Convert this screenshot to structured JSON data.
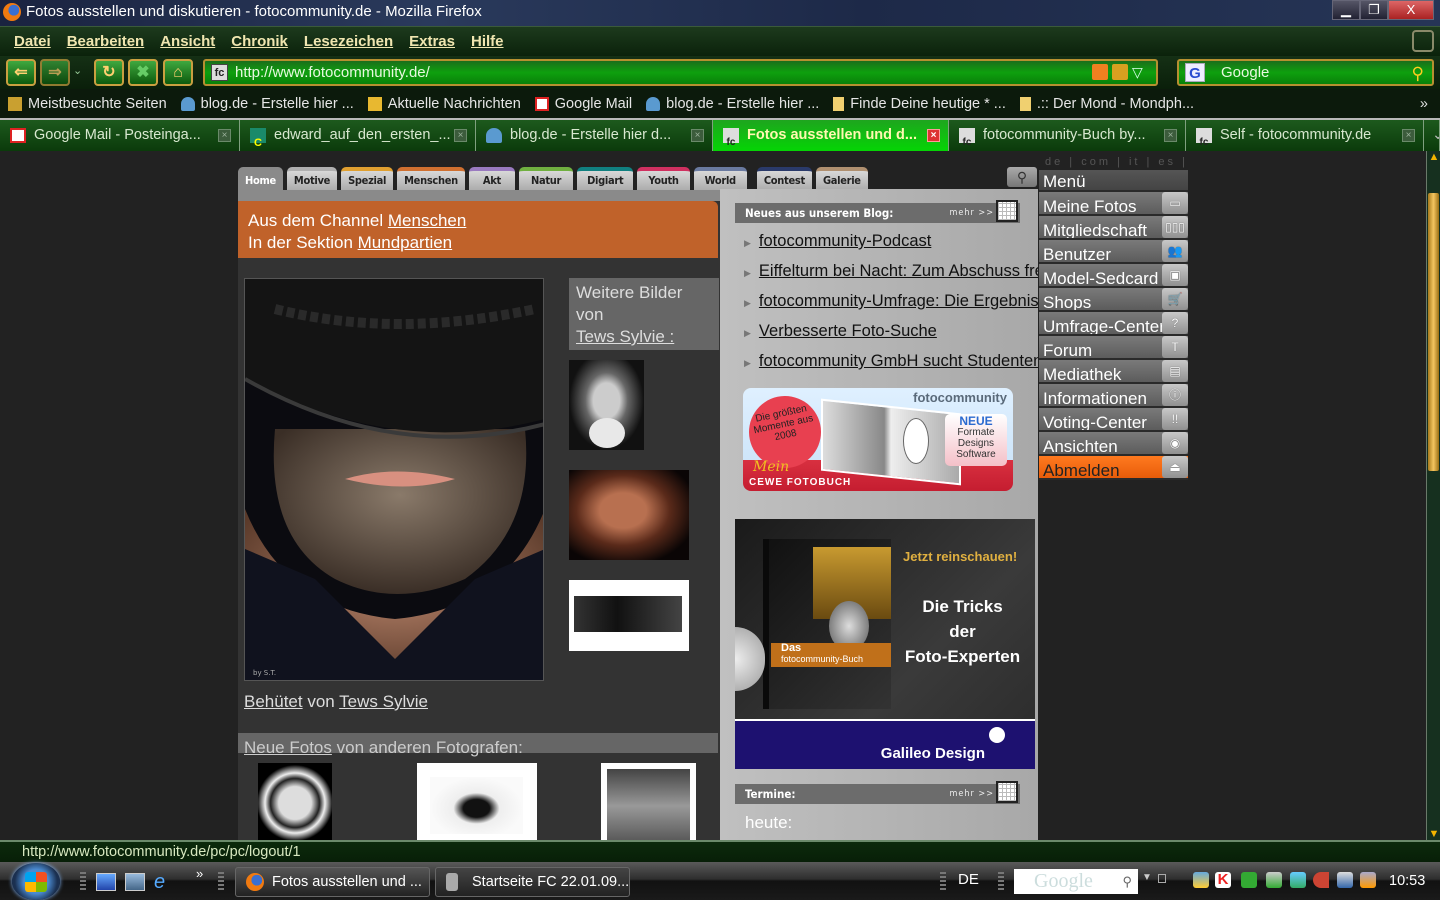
{
  "window": {
    "title": "Fotos ausstellen und diskutieren - fotocommunity.de - Mozilla Firefox",
    "controls": {
      "minimize": "▁",
      "restore": "❐",
      "close": "X"
    }
  },
  "menubar": [
    "Datei",
    "Bearbeiten",
    "Ansicht",
    "Chronik",
    "Lesezeichen",
    "Extras",
    "Hilfe"
  ],
  "navbar": {
    "back": "⇐",
    "forward": "⇒",
    "dropdown": "⌄",
    "reload": "↻",
    "stop": "✖",
    "home": "⌂",
    "url": "http://www.fotocommunity.de/",
    "site_icon": "fc",
    "search_engine": "G",
    "search_placeholder": "Google",
    "search_icon": "⚲"
  },
  "bookmarks": {
    "items": [
      {
        "label": "Meistbesuchte Seiten",
        "icon": "folder-icon"
      },
      {
        "label": "blog.de - Erstelle hier ...",
        "icon": "blog-icon"
      },
      {
        "label": "Aktuelle Nachrichten",
        "icon": "rss-folder-icon"
      },
      {
        "label": "Google Mail",
        "icon": "gmail-icon"
      },
      {
        "label": "blog.de - Erstelle hier ...",
        "icon": "blog-icon"
      },
      {
        "label": "Finde Deine heutige * ...",
        "icon": "page-icon"
      },
      {
        "label": ".:: Der Mond - Mondph...",
        "icon": "page-icon"
      }
    ],
    "more": "»"
  },
  "tabs": [
    {
      "label": "Google Mail - Posteinga...",
      "icon": "gmail-icon",
      "active": false
    },
    {
      "label": "edward_auf_den_ersten_...",
      "icon": "c-icon",
      "active": false
    },
    {
      "label": "blog.de - Erstelle hier d...",
      "icon": "blog-icon",
      "active": false
    },
    {
      "label": "Fotos ausstellen und d...",
      "icon": "fc-icon",
      "active": true
    },
    {
      "label": "fotocommunity-Buch by...",
      "icon": "fc-icon",
      "active": false
    },
    {
      "label": "Self - fotocommunity.de",
      "icon": "fc-icon",
      "active": false
    }
  ],
  "tab_close": "×",
  "site": {
    "langs": "de | com | it | es |",
    "nav_tabs": [
      {
        "label": "Home",
        "color": "#8a8a8a"
      },
      {
        "label": "Motive",
        "color": "#b0b0b0"
      },
      {
        "label": "Spezial",
        "color": "#e0a030"
      },
      {
        "label": "Menschen",
        "color": "#d07030"
      },
      {
        "label": "Akt",
        "color": "#9a7ac0"
      },
      {
        "label": "Natur",
        "color": "#70b040"
      },
      {
        "label": "Digiart",
        "color": "#108080"
      },
      {
        "label": "Youth",
        "color": "#d03060"
      },
      {
        "label": "World",
        "color": "#6a7aa0"
      },
      {
        "label": "Contest",
        "color": "#2a3a6a"
      },
      {
        "label": "Galerie",
        "color": "#b09070"
      }
    ],
    "channel": {
      "prefix": "Aus dem Channel ",
      "channel_link": "Menschen",
      "section_prefix": " In der Sektion ",
      "section_link": "Mundpartien"
    },
    "main_photo": {
      "title": "Behütet",
      "by": " von ",
      "author": "Tews Sylvie",
      "signature": "by S.T."
    },
    "weitere": {
      "line1": "Weitere Bilder",
      "line2": "von",
      "author_link": "Tews Sylvie :"
    },
    "neue_fotos": {
      "link": "Neue Fotos",
      "rest": " von anderen Fotografen:"
    },
    "blog": {
      "header": "Neues aus unserem Blog:",
      "mehr": "mehr >>",
      "items": [
        "fotocommunity-Podcast",
        "Eiffelturm bei Nacht: Zum Abschuss freigegeben",
        "fotocommunity-Umfrage: Die Ergebnisse",
        "Verbesserte Foto-Suche",
        "fotocommunity GmbH sucht Studenten"
      ]
    },
    "banner_fotobuch": {
      "badge": "Die größten Momente aus 2008",
      "brand": "fotocommunity",
      "neue": "NEUE",
      "features": "Formate Designs Software",
      "mein": "Mein",
      "cewe": "CEWE FOTOBUCH"
    },
    "banner_galileo": {
      "cta": "Jetzt reinschauen!",
      "headline1": "Die Tricks",
      "headline2": "der",
      "headline3": "Foto-Experten",
      "book_das": "Das",
      "book_title": "fotocommunity-Buch",
      "publisher": "Galileo Design"
    },
    "termine": {
      "header": "Termine:",
      "mehr": "mehr >>",
      "heute": "heute:"
    },
    "menu": {
      "title": "Menü",
      "items": [
        {
          "label": "Meine Fotos",
          "icon": "▭"
        },
        {
          "label": "Mitgliedschaft",
          "icon": "▯▯▯"
        },
        {
          "label": "Benutzer",
          "icon": "👥"
        },
        {
          "label": "Model-Sedcard",
          "icon": "▣"
        },
        {
          "label": "Shops",
          "icon": "🛒"
        },
        {
          "label": "Umfrage-Center",
          "icon": "?"
        },
        {
          "label": "Forum",
          "icon": "T"
        },
        {
          "label": "Mediathek",
          "icon": "▤"
        },
        {
          "label": "Informationen",
          "icon": "ⓘ"
        },
        {
          "label": "Voting-Center",
          "icon": "!!"
        },
        {
          "label": "Ansichten",
          "icon": "◉"
        },
        {
          "label": "Abmelden",
          "icon": "⏏"
        }
      ]
    },
    "search_icon": "⚲"
  },
  "statusbar": {
    "text": "http://www.fotocommunity.de/pc/pc/logout/1"
  },
  "taskbar": {
    "more": "»",
    "buttons": [
      {
        "label": "Fotos ausstellen und ..."
      },
      {
        "label": "Startseite FC 22.01.09..."
      }
    ],
    "lang": "DE",
    "google": "Google",
    "clock": "10:53"
  }
}
